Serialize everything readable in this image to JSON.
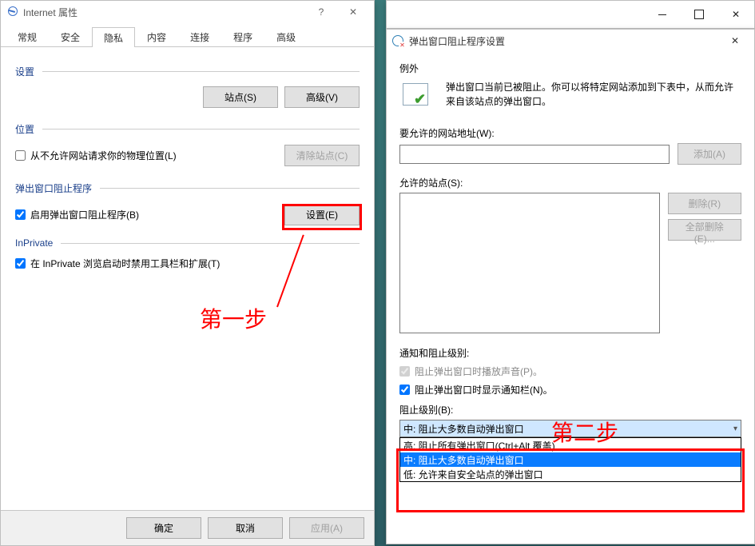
{
  "iprop": {
    "title": "Internet 属性",
    "tabs": [
      "常规",
      "安全",
      "隐私",
      "内容",
      "连接",
      "程序",
      "高级"
    ],
    "active_tab_index": 2,
    "settings_label": "设置",
    "sites_btn": "站点(S)",
    "advanced_btn": "高级(V)",
    "location_label": "位置",
    "location_checkbox": "从不允许网站请求你的物理位置(L)",
    "clear_sites_btn": "清除站点(C)",
    "popup_section": "弹出窗口阻止程序",
    "enable_popup_checkbox": "启用弹出窗口阻止程序(B)",
    "settings_btn": "设置(E)",
    "inprivate_section": "InPrivate",
    "inprivate_checkbox": "在 InPrivate 浏览启动时禁用工具栏和扩展(T)",
    "ok_btn": "确定",
    "cancel_btn": "取消",
    "apply_btn": "应用(A)"
  },
  "popwin": {
    "title": "弹出窗口阻止程序设置",
    "exceptions_label": "例外",
    "info_text": "弹出窗口当前已被阻止。你可以将特定网站添加到下表中，从而允许来自该站点的弹出窗口。",
    "allow_addr_label": "要允许的网站地址(W):",
    "add_btn": "添加(A)",
    "allowed_sites_label": "允许的站点(S):",
    "remove_btn": "删除(R)",
    "remove_all_btn": "全部删除(E)...",
    "notif_section": "通知和阻止级别:",
    "sound_checkbox": "阻止弹出窗口时播放声音(P)。",
    "notif_checkbox": "阻止弹出窗口时显示通知栏(N)。",
    "block_level_label": "阻止级别(B):",
    "selected_level": "中: 阻止大多数自动弹出窗口",
    "level_options": [
      "高: 阻止所有弹出窗口(Ctrl+Alt 覆盖)",
      "中: 阻止大多数自动弹出窗口",
      "低: 允许来自安全站点的弹出窗口"
    ],
    "selected_index": 1
  },
  "annotations": {
    "step1": "第一步",
    "step2": "第二步"
  }
}
